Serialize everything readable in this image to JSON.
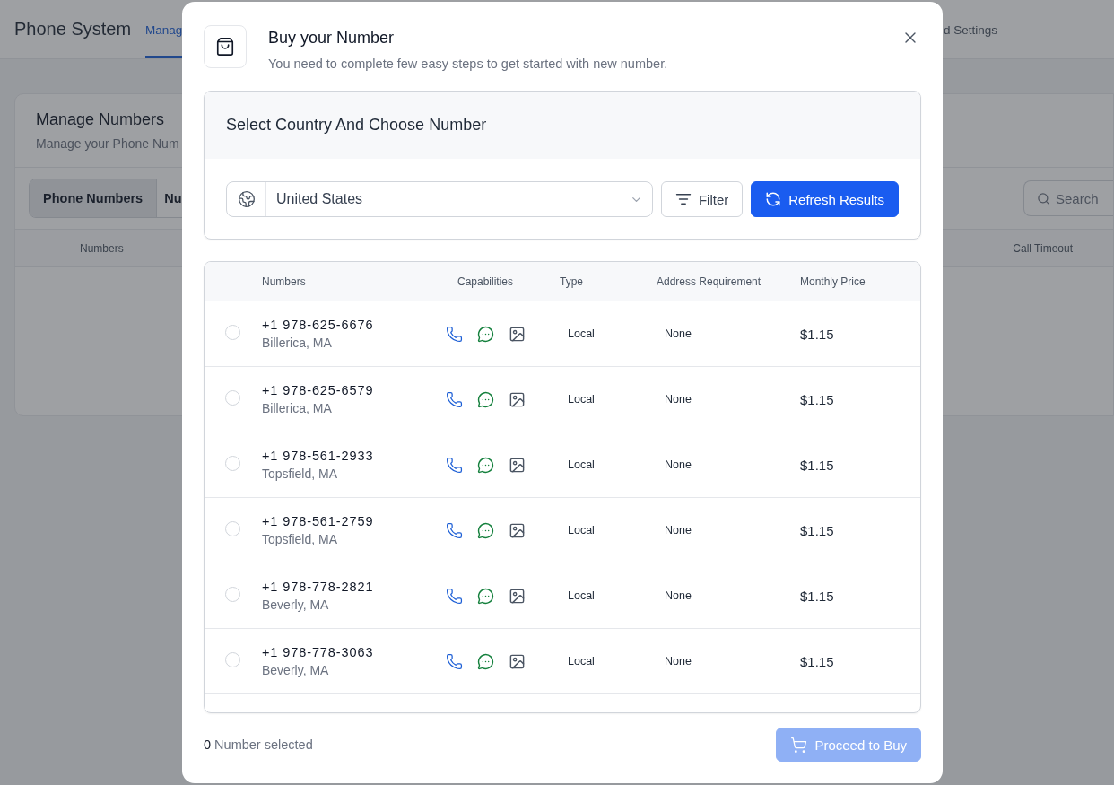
{
  "background": {
    "app_title": "Phone System",
    "nav_tabs": [
      {
        "label": "Manag",
        "selected": true
      },
      {
        "label": "d Settings",
        "selected": false
      }
    ],
    "card": {
      "title": "Manage Numbers",
      "subtitle": "Manage your Phone Num",
      "tabs": [
        {
          "label": "Phone Numbers",
          "selected": true
        },
        {
          "label": "Nu",
          "selected": false
        }
      ],
      "search_button": "Search",
      "columns": [
        "Numbers",
        "Call Timeout"
      ]
    }
  },
  "modal": {
    "title": "Buy your Number",
    "subtitle": "You need to complete few easy steps to get started with new number.",
    "section_title": "Select Country And Choose Number",
    "country_select": {
      "value": "United States"
    },
    "filter_button": "Filter",
    "refresh_button": "Refresh Results",
    "table": {
      "columns": [
        "Numbers",
        "Capabilities",
        "Type",
        "Address Requirement",
        "Monthly Price"
      ],
      "rows": [
        {
          "selected": false,
          "number": "+1 978-625-6676",
          "location": "Billerica, MA",
          "capabilities": [
            {
              "kind": "voice"
            },
            {
              "kind": "sms"
            },
            {
              "kind": "mms"
            }
          ],
          "type": "Local",
          "address": "None",
          "price": "$1.15"
        },
        {
          "selected": false,
          "number": "+1 978-625-6579",
          "location": "Billerica, MA",
          "capabilities": [
            {
              "kind": "voice"
            },
            {
              "kind": "sms"
            },
            {
              "kind": "mms"
            }
          ],
          "type": "Local",
          "address": "None",
          "price": "$1.15"
        },
        {
          "selected": false,
          "number": "+1 978-561-2933",
          "location": "Topsfield, MA",
          "capabilities": [
            {
              "kind": "voice"
            },
            {
              "kind": "sms"
            },
            {
              "kind": "mms"
            }
          ],
          "type": "Local",
          "address": "None",
          "price": "$1.15"
        },
        {
          "selected": false,
          "number": "+1 978-561-2759",
          "location": "Topsfield, MA",
          "capabilities": [
            {
              "kind": "voice"
            },
            {
              "kind": "sms"
            },
            {
              "kind": "mms"
            }
          ],
          "type": "Local",
          "address": "None",
          "price": "$1.15"
        },
        {
          "selected": false,
          "number": "+1 978-778-2821",
          "location": "Beverly, MA",
          "capabilities": [
            {
              "kind": "voice"
            },
            {
              "kind": "sms"
            },
            {
              "kind": "mms"
            }
          ],
          "type": "Local",
          "address": "None",
          "price": "$1.15"
        },
        {
          "selected": false,
          "number": "+1 978-778-3063",
          "location": "Beverly, MA",
          "capabilities": [
            {
              "kind": "voice"
            },
            {
              "kind": "sms"
            },
            {
              "kind": "mms"
            }
          ],
          "type": "Local",
          "address": "None",
          "price": "$1.15"
        }
      ]
    },
    "footer": {
      "selected_count": "0",
      "selected_label": "Number selected",
      "proceed_button": {
        "label": "Proceed to Buy",
        "disabled": true
      }
    }
  }
}
